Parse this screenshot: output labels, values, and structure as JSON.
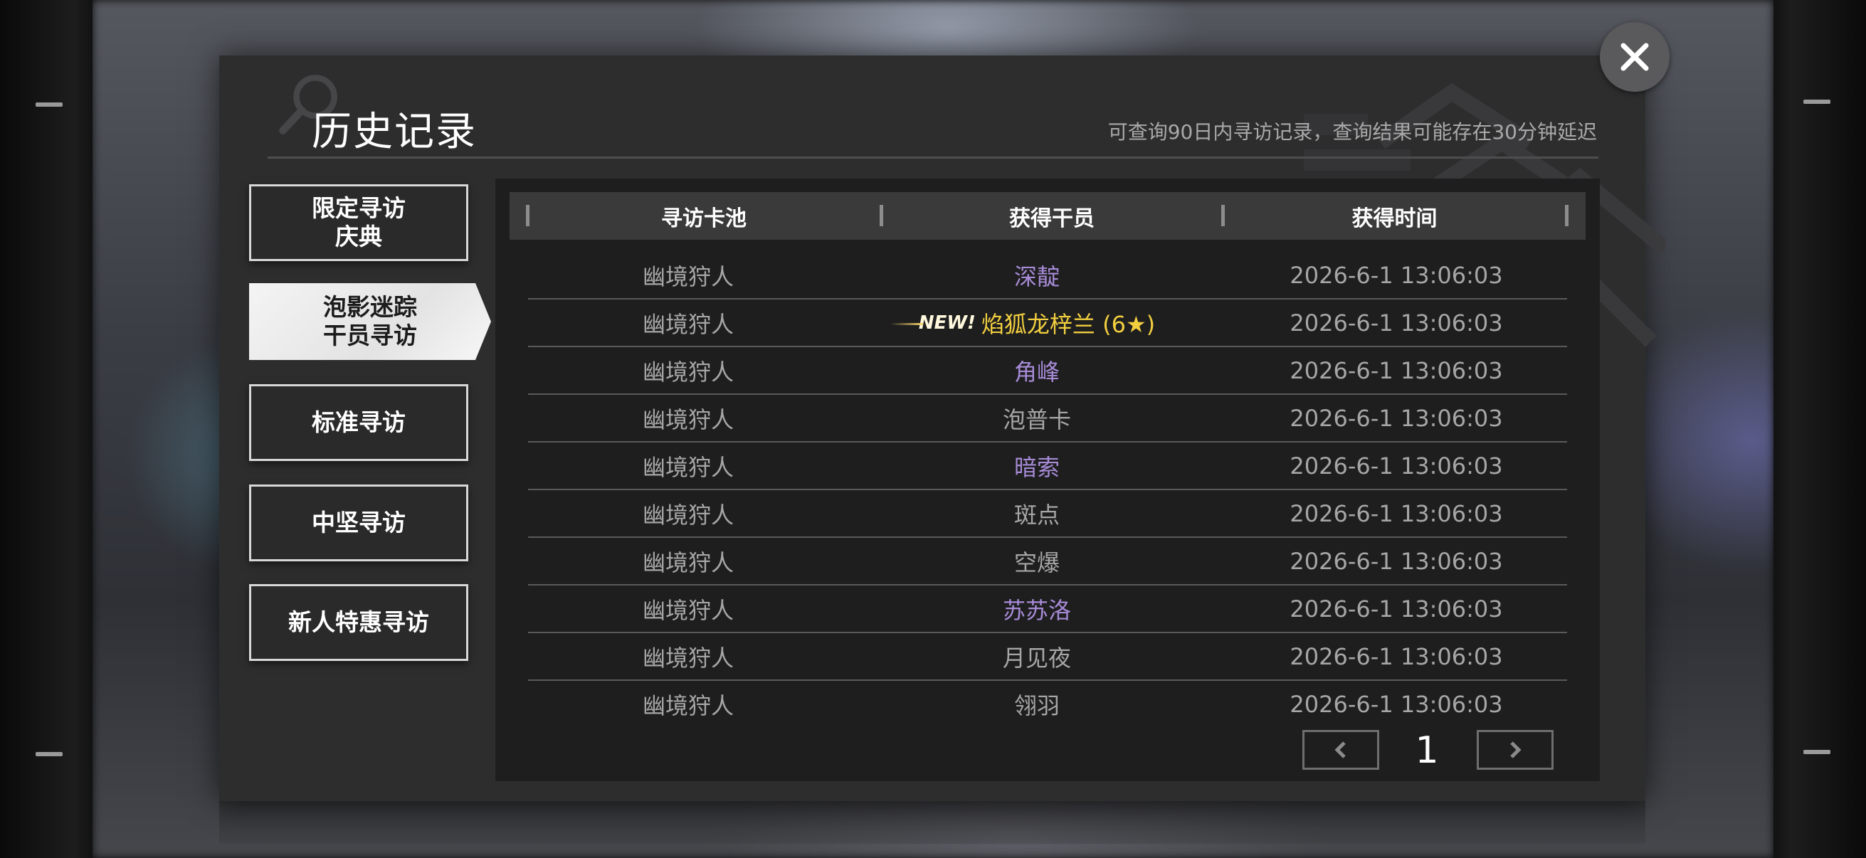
{
  "dialog": {
    "title": "历史记录",
    "notice": "可查询90日内寻访记录，查询结果可能存在30分钟延迟"
  },
  "categories": [
    {
      "lines": [
        "限定寻访",
        "庆典"
      ],
      "active": false
    },
    {
      "lines": [
        "泡影迷踪",
        "干员寻访"
      ],
      "active": true
    },
    {
      "lines": [
        "标准寻访"
      ],
      "active": false
    },
    {
      "lines": [
        "中坚寻访"
      ],
      "active": false
    },
    {
      "lines": [
        "新人特惠寻访"
      ],
      "active": false
    }
  ],
  "table": {
    "headers": [
      "寻访卡池",
      "获得干员",
      "获得时间"
    ],
    "rows": [
      {
        "pool": "幽境狩人",
        "operator": "深靛",
        "time": "2026-6-1 13:06:03",
        "rarity_color": "#a78bd6",
        "is_new": false
      },
      {
        "pool": "幽境狩人",
        "operator": "焰狐龙梓兰 (6★)",
        "time": "2026-6-1 13:06:03",
        "rarity_color": "#f2cf3f",
        "is_new": true,
        "new_label": "NEW!"
      },
      {
        "pool": "幽境狩人",
        "operator": "角峰",
        "time": "2026-6-1 13:06:03",
        "rarity_color": "#a78bd6",
        "is_new": false
      },
      {
        "pool": "幽境狩人",
        "operator": "泡普卡",
        "time": "2026-6-1 13:06:03",
        "rarity_color": "#a6a6a6",
        "is_new": false
      },
      {
        "pool": "幽境狩人",
        "operator": "暗索",
        "time": "2026-6-1 13:06:03",
        "rarity_color": "#a78bd6",
        "is_new": false
      },
      {
        "pool": "幽境狩人",
        "operator": "斑点",
        "time": "2026-6-1 13:06:03",
        "rarity_color": "#a6a6a6",
        "is_new": false
      },
      {
        "pool": "幽境狩人",
        "operator": "空爆",
        "time": "2026-6-1 13:06:03",
        "rarity_color": "#a6a6a6",
        "is_new": false
      },
      {
        "pool": "幽境狩人",
        "operator": "苏苏洛",
        "time": "2026-6-1 13:06:03",
        "rarity_color": "#a78bd6",
        "is_new": false
      },
      {
        "pool": "幽境狩人",
        "operator": "月见夜",
        "time": "2026-6-1 13:06:03",
        "rarity_color": "#a6a6a6",
        "is_new": false
      },
      {
        "pool": "幽境狩人",
        "operator": "翎羽",
        "time": "2026-6-1 13:06:03",
        "rarity_color": "#a6a6a6",
        "is_new": false
      }
    ]
  },
  "pagination": {
    "current_page": "1",
    "prev_icon": "chevron-left-icon",
    "next_icon": "chevron-right-icon"
  },
  "close_icon": "close-icon"
}
